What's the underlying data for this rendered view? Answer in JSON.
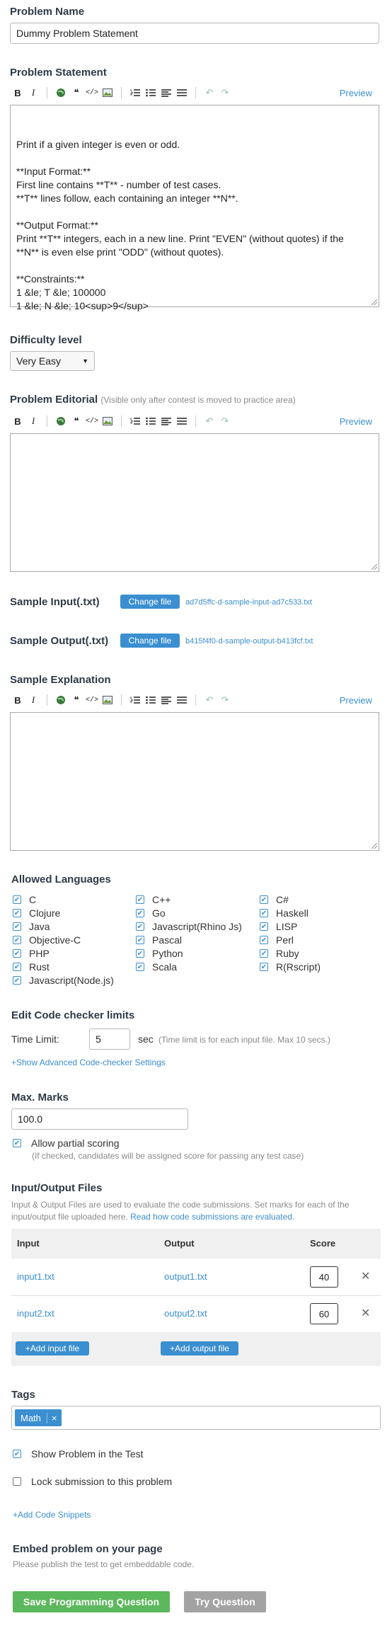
{
  "problem_name": {
    "label": "Problem Name",
    "value": "Dummy Problem Statement"
  },
  "statement": {
    "label": "Problem Statement",
    "preview": "Preview",
    "lines": [
      "Print if a given integer is even or odd.",
      "",
      "**Input Format:**",
      "First line contains **T** - number of test cases.",
      "**T** lines follow, each containing an integer **N**.",
      "",
      "**Output Format:**",
      "Print **T** integers, each in a new line. Print \"EVEN\" (without quotes) if the",
      "**N** is even else print \"ODD\" (without quotes).",
      "",
      "**Constraints:**",
      "1 &le; T &le; 100000",
      "1 &le; N &le; 10<sup>9</sup>"
    ]
  },
  "toolbar": {
    "bold": "B",
    "italic": "I",
    "quote": "❝",
    "code": "</>",
    "undo": "↶",
    "redo": "↷"
  },
  "difficulty": {
    "label": "Difficulty level",
    "value": "Very Easy"
  },
  "editorial": {
    "label": "Problem Editorial",
    "note": "(Visible only after contest is moved to practice area)",
    "preview": "Preview"
  },
  "sample_input": {
    "label": "Sample Input(.txt)",
    "button": "Change file",
    "file": "ad7d5ffc-d-sample-input-ad7c533.txt"
  },
  "sample_output": {
    "label": "Sample Output(.txt)",
    "button": "Change file",
    "file": "b415f4f0-d-sample-output-b413fcf.txt"
  },
  "explanation": {
    "label": "Sample Explanation",
    "preview": "Preview"
  },
  "languages": {
    "label": "Allowed Languages",
    "col1": [
      "C",
      "Clojure",
      "Java",
      "Objective-C",
      "PHP",
      "Rust",
      "Javascript(Node.js)"
    ],
    "col2": [
      "C++",
      "Go",
      "Javascript(Rhino Js)",
      "Pascal",
      "Python",
      "Scala"
    ],
    "col3": [
      "C#",
      "Haskell",
      "LISP",
      "Perl",
      "Ruby",
      "R(Rscript)"
    ]
  },
  "limits": {
    "label": "Edit Code checker limits",
    "time_label": "Time Limit:",
    "time_value": "5",
    "unit": "sec",
    "note": "(Time limit is for each input file. Max 10 secs.)",
    "advanced": "+Show Advanced Code-checker Settings"
  },
  "marks": {
    "label": "Max. Marks",
    "value": "100.0",
    "partial_label": "Allow partial scoring",
    "partial_note": "(If checked, candidates will be assigned score for passing any test case)"
  },
  "io": {
    "label": "Input/Output Files",
    "desc": "Input & Output Files are used to evaluate the code submissions. Set marks for each of the input/output file uploaded here.",
    "desc_link": "Read how code submissions are evaluated.",
    "headers": {
      "input": "Input",
      "output": "Output",
      "score": "Score"
    },
    "rows": [
      {
        "input": "input1.txt",
        "output": "output1.txt",
        "score": "40"
      },
      {
        "input": "input2.txt",
        "output": "output2.txt",
        "score": "60"
      }
    ],
    "add_input": "+Add input file",
    "add_output": "+Add output file",
    "remove": "✕"
  },
  "tags": {
    "label": "Tags",
    "items": [
      "Math"
    ],
    "remove": "×"
  },
  "show_problem": "Show Problem in the Test",
  "lock_submission": "Lock submission to this problem",
  "add_snippets": "+Add Code Snippets",
  "embed": {
    "label": "Embed problem on your page",
    "note": "Please publish the test to get embeddable code."
  },
  "actions": {
    "save": "Save Programming Question",
    "try": "Try Question"
  },
  "colors": {
    "accent": "#3b8fd0",
    "save": "#5cb85c",
    "try": "#a3a3a3"
  }
}
